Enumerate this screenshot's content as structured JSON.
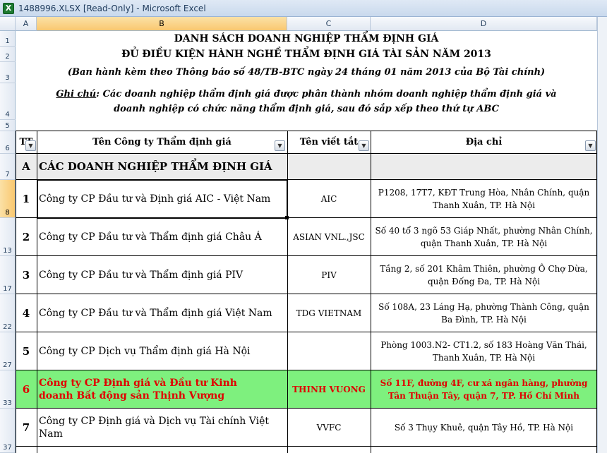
{
  "window": {
    "title": "1488996.XLSX  [Read-Only] - Microsoft Excel",
    "app_icon": "X"
  },
  "columns": [
    "A",
    "B",
    "C",
    "D"
  ],
  "rows": [
    "1",
    "2",
    "3",
    "4",
    "5",
    "6",
    "7",
    "8",
    "13",
    "17",
    "22",
    "27",
    "33",
    "37"
  ],
  "sheet": {
    "title1": "DANH SÁCH DOANH NGHIỆP THẨM ĐỊNH GIÁ",
    "title2": "ĐỦ ĐIỀU KIỆN HÀNH NGHỀ THẨM ĐỊNH GIÁ TÀI SẢN NĂM 2013",
    "subtitle": "(Ban hành kèm theo Thông báo số  48/TB-BTC ngày 24  tháng 01 năm 2013 của Bộ Tài chính)",
    "note_label": "Ghi chú",
    "note_line1": ": Các doanh nghiệp thẩm định giá được phân thành nhóm doanh nghiệp thẩm định giá và",
    "note_line2": "doanh nghiệp có chức năng thẩm định giá, sau đó sắp xếp theo thứ tự ABC"
  },
  "headers": {
    "tt": "TT",
    "company": "Tên Công ty Thẩm định giá",
    "abbr": "Tên viết tắt",
    "address": "Địa chỉ"
  },
  "section": {
    "letter": "A",
    "label": "CÁC DOANH NGHIỆP THẨM ĐỊNH GIÁ"
  },
  "entries": [
    {
      "tt": "1",
      "company": "Công ty CP Đầu tư và Định giá AIC - Việt Nam",
      "abbr": "AIC",
      "address": "P1208, 17T7, KĐT Trung Hòa, Nhân Chính, quận Thanh Xuân, TP. Hà Nội"
    },
    {
      "tt": "2",
      "company": "Công ty CP Đầu tư và Thẩm định giá Châu Á",
      "abbr": "ASIAN VNL.,JSC",
      "address": "Số 40 tổ 3 ngõ 53 Giáp Nhất, phường Nhân Chính, quận Thanh Xuân, TP. Hà Nội"
    },
    {
      "tt": "3",
      "company": "Công ty CP Đầu tư và Thẩm định giá PIV",
      "abbr": "PIV",
      "address": "Tầng 2, số 201 Khâm Thiên, phường Ô Chợ Dừa, quận Đống Đa, TP. Hà Nội"
    },
    {
      "tt": "4",
      "company": "Công ty CP Đầu tư và Thẩm định giá Việt Nam",
      "abbr": "TDG VIETNAM",
      "address": "Số 108A, 23 Láng Hạ, phường Thành Công, quận Ba Đình, TP. Hà Nội"
    },
    {
      "tt": "5",
      "company": "Công ty CP Dịch vụ Thẩm định giá Hà Nội",
      "abbr": "",
      "address": "Phòng 1003.N2- CT1.2, số 183 Hoàng Văn Thái, Thanh Xuân, TP. Hà Nội"
    },
    {
      "tt": "6",
      "company": "Công ty CP Định giá và Đầu tư Kinh doanh Bất động sản Thịnh Vượng",
      "abbr": "THINH VUONG",
      "address": "Số 11F, đường 4F, cư xá ngân hàng, phường Tân Thuận Tây, quận 7, TP. Hồ Chí Minh"
    },
    {
      "tt": "7",
      "company": "Công ty CP Định giá và Dịch vụ Tài chính Việt Nam",
      "abbr": "VVFC",
      "address": "Số 3 Thụy Khuê, quận Tây Hồ,  TP. Hà Nội"
    }
  ],
  "colors": {
    "highlight_row": "#7ef07e",
    "highlight_text": "#e00000",
    "section_bg": "#ececec"
  }
}
